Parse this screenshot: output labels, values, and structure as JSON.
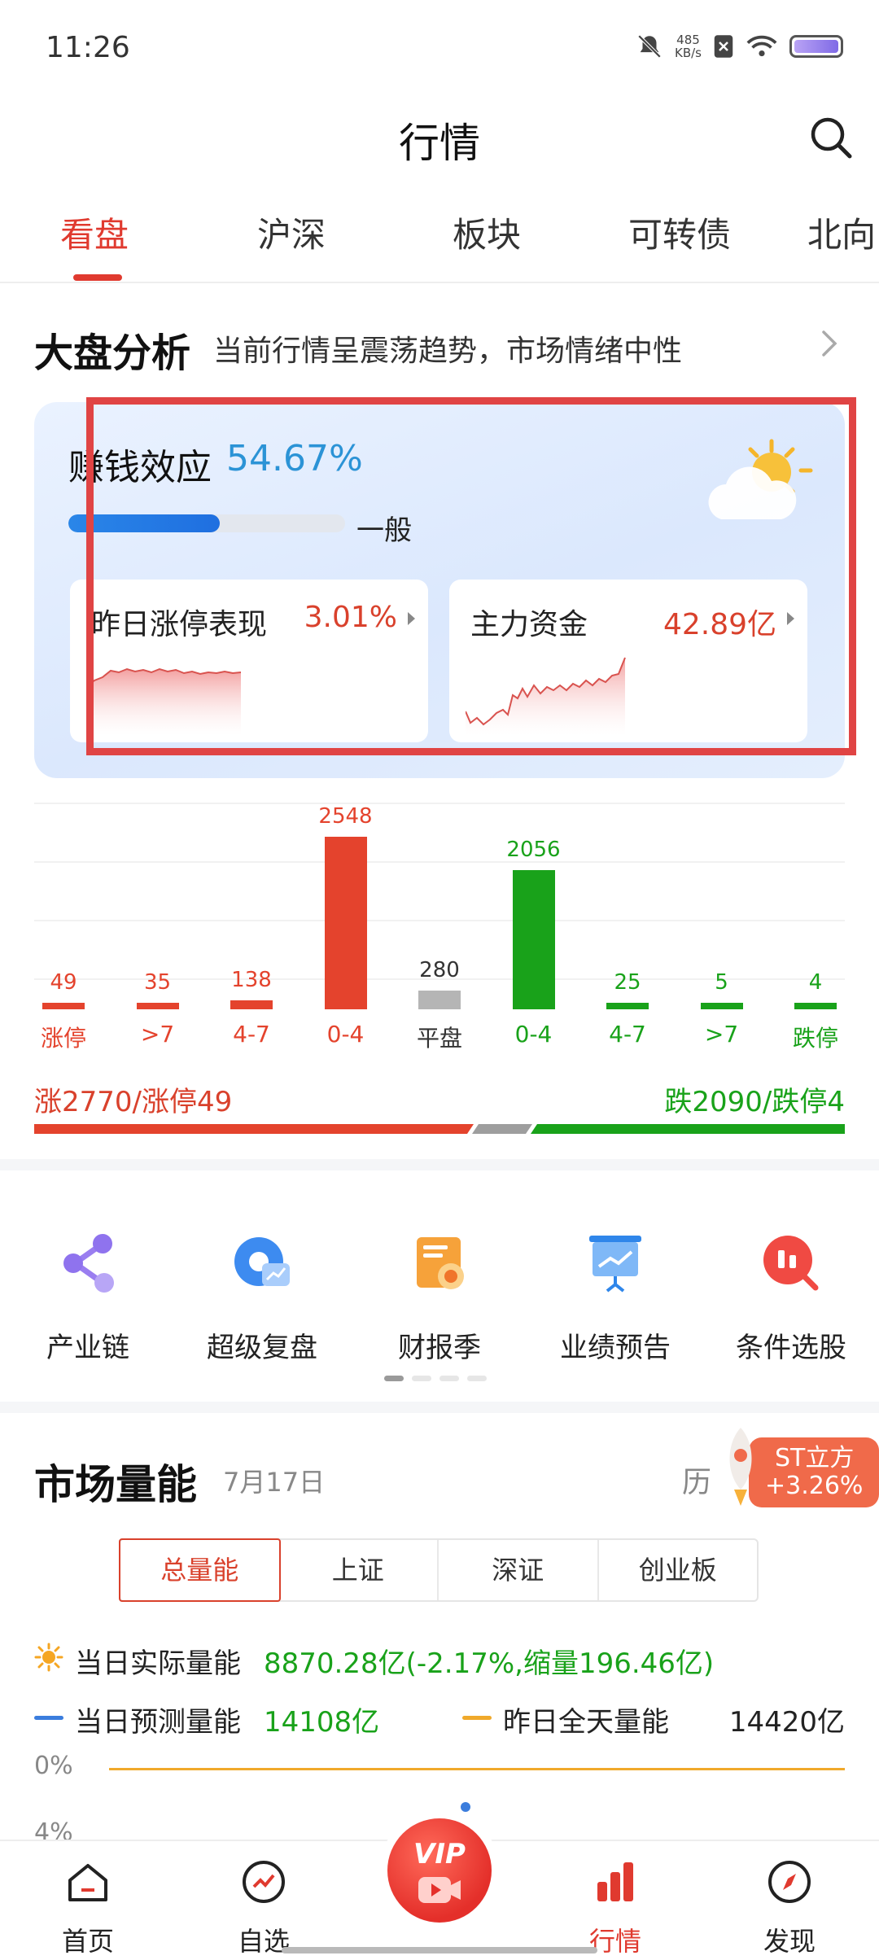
{
  "status_bar": {
    "time": "11:26",
    "net_speed_value": "485",
    "net_speed_unit": "KB/s"
  },
  "header": {
    "title": "行情"
  },
  "tabs": [
    {
      "label": "看盘",
      "active": true
    },
    {
      "label": "沪深"
    },
    {
      "label": "板块"
    },
    {
      "label": "可转债"
    },
    {
      "label": "北向"
    }
  ],
  "market_analysis": {
    "title": "大盘分析",
    "description": "当前行情呈震荡趋势，市场情绪中性",
    "effect_label": "赚钱效应",
    "effect_value": "54.67%",
    "effect_progress": 0.5467,
    "effect_level": "一般",
    "weather_icon": "partly-cloudy-icon",
    "cards": [
      {
        "label": "昨日涨停表现",
        "value": "3.01%"
      },
      {
        "label": "主力资金",
        "value": "42.89亿"
      }
    ]
  },
  "distribution": {
    "chart_data": {
      "type": "bar",
      "categories": [
        "涨停",
        ">7",
        "4-7",
        "0-4",
        "平盘",
        "0-4",
        "4-7",
        ">7",
        "跌停"
      ],
      "values": [
        49,
        35,
        138,
        2548,
        280,
        2056,
        25,
        5,
        4
      ],
      "colors": [
        "#e4432d",
        "#e4432d",
        "#e4432d",
        "#e4432d",
        "#b5b5b5",
        "#19a21a",
        "#19a21a",
        "#19a21a",
        "#19a21a"
      ],
      "ylim": [
        0,
        2548
      ]
    },
    "summary_left": "涨2770/涨停49",
    "summary_right": "跌2090/跌停4"
  },
  "shortcuts": [
    {
      "label": "产业链",
      "icon": "share-network-icon"
    },
    {
      "label": "超级复盘",
      "icon": "replay-chart-icon"
    },
    {
      "label": "财报季",
      "icon": "report-scroll-icon"
    },
    {
      "label": "业绩预告",
      "icon": "presentation-board-icon"
    },
    {
      "label": "条件选股",
      "icon": "stock-filter-icon"
    }
  ],
  "market_volume": {
    "title": "市场量能",
    "date": "7月17日",
    "history_label": "历",
    "segments": [
      "总量能",
      "上证",
      "深证",
      "创业板"
    ],
    "actual_label": "当日实际量能",
    "actual_value": "8870.28亿(-2.17%,缩量196.46亿)",
    "forecast_label": "当日预测量能",
    "forecast_value": "14108亿",
    "yesterday_label": "昨日全天量能",
    "yesterday_value": "14420亿",
    "axis_ticks": [
      "0%",
      "4%"
    ],
    "colors": {
      "forecast": "#3b7ddd",
      "yesterday": "#f0a92b"
    }
  },
  "floating_ad": {
    "name": "ST立方",
    "change": "+3.26%"
  },
  "bottom_nav": [
    {
      "label": "首页",
      "icon": "home-icon"
    },
    {
      "label": "自选",
      "icon": "trend-circle-icon"
    },
    {
      "label": "行情",
      "icon": "bar-chart-icon",
      "active": true
    },
    {
      "label": "发现",
      "icon": "compass-icon"
    }
  ],
  "vip_button": {
    "label": "VIP"
  }
}
